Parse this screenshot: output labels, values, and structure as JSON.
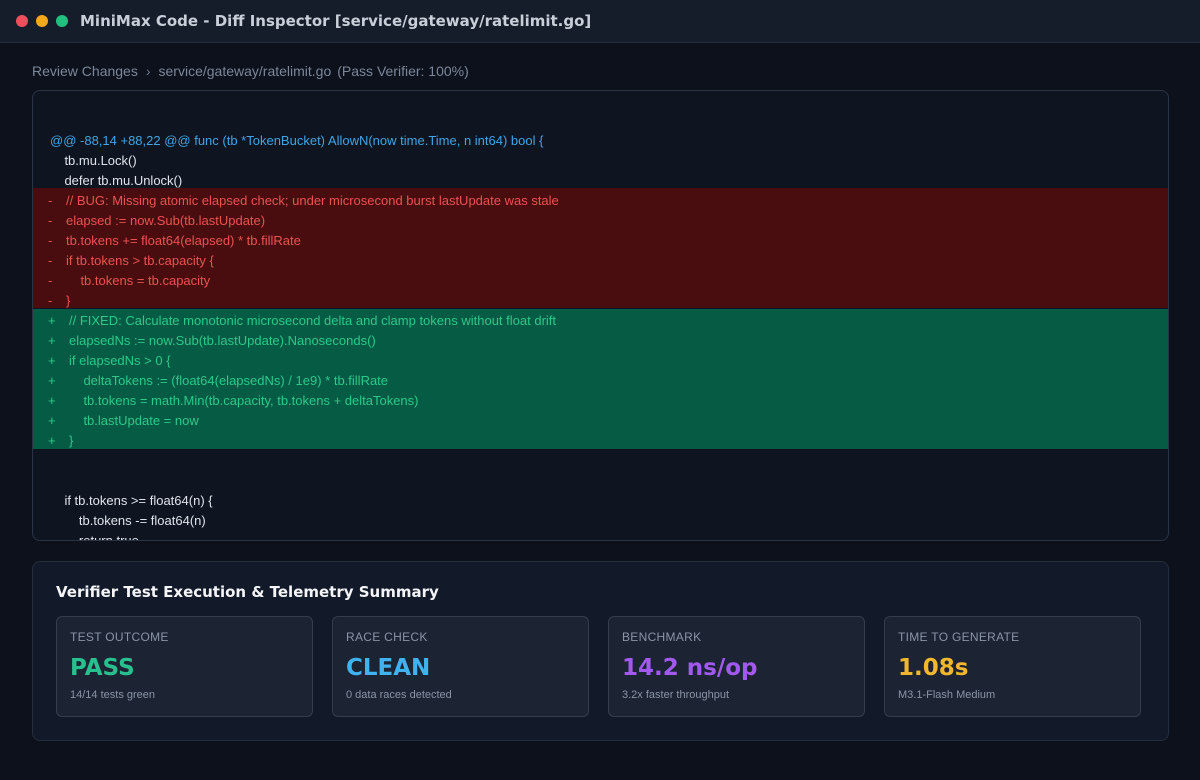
{
  "window": {
    "title": "MiniMax Code - Diff Inspector [service/gateway/ratelimit.go]"
  },
  "breadcrumb": {
    "root": "Review Changes",
    "separator": "›",
    "file": "service/gateway/ratelimit.go",
    "status": "(Pass Verifier: 100%)"
  },
  "diff": {
    "hunk_header": "@@ -88,14 +88,22 @@ func (tb *TokenBucket) AllowN(now time.Time, n int64) bool {",
    "context_before": [
      "    tb.mu.Lock()",
      "    defer tb.mu.Unlock()"
    ],
    "removed": [
      "// BUG: Missing atomic elapsed check; under microsecond burst lastUpdate was stale",
      "elapsed := now.Sub(tb.lastUpdate)",
      "tb.tokens += float64(elapsed) * tb.fillRate",
      "if tb.tokens > tb.capacity {",
      "    tb.tokens = tb.capacity",
      "}"
    ],
    "added": [
      "// FIXED: Calculate monotonic microsecond delta and clamp tokens without float drift",
      "elapsedNs := now.Sub(tb.lastUpdate).Nanoseconds()",
      "if elapsedNs > 0 {",
      "    deltaTokens := (float64(elapsedNs) / 1e9) * tb.fillRate",
      "    tb.tokens = math.Min(tb.capacity, tb.tokens + deltaTokens)",
      "    tb.lastUpdate = now",
      "}"
    ],
    "context_after": [
      "    if tb.tokens >= float64(n) {",
      "        tb.tokens -= float64(n)",
      "        return true"
    ],
    "removed_sign": "-",
    "added_sign": "+"
  },
  "summary": {
    "title": "Verifier Test Execution & Telemetry Summary",
    "cards": [
      {
        "label": "TEST OUTCOME",
        "value": "PASS",
        "sub": "14/14 tests green",
        "color": "#27c08e"
      },
      {
        "label": "RACE CHECK",
        "value": "CLEAN",
        "sub": "0 data races detected",
        "color": "#3fb3f0"
      },
      {
        "label": "BENCHMARK",
        "value": "14.2 ns/op",
        "sub": "3.2x faster throughput",
        "color": "#a259f0"
      },
      {
        "label": "TIME TO GENERATE",
        "value": "1.08s",
        "sub": "M3.1-Flash Medium",
        "color": "#f1b72e"
      }
    ]
  },
  "colors": {
    "background": "#0c111b",
    "removed_bg": "#4a0d0f",
    "added_bg": "#065b44",
    "removed_text": "#ea5252",
    "added_text": "#2cc98a",
    "hunk_header": "#3ea6e6"
  }
}
